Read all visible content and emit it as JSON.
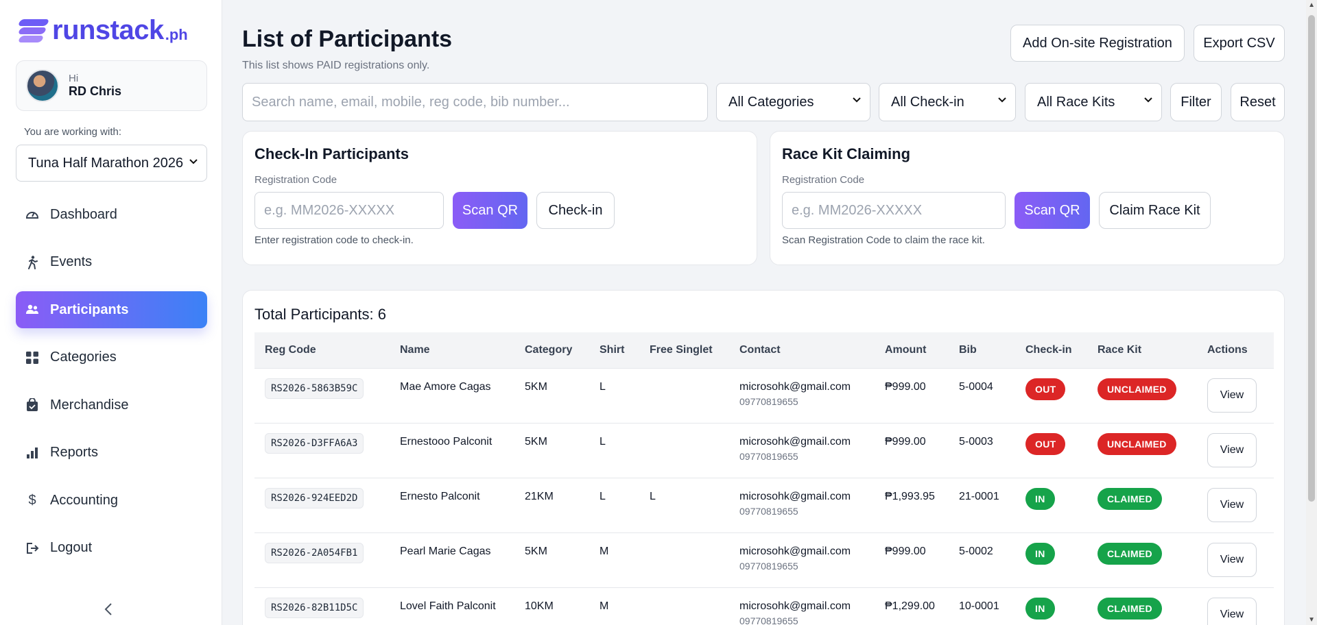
{
  "brand": {
    "name": "runstack",
    "suffix": ".ph"
  },
  "user": {
    "greeting": "Hi",
    "name": "RD Chris"
  },
  "working_with": {
    "label": "You are working with:",
    "selected_event": "Tuna Half Marathon 2026"
  },
  "nav": {
    "items": [
      {
        "label": "Dashboard",
        "icon": "gauge-icon"
      },
      {
        "label": "Events",
        "icon": "runner-icon"
      },
      {
        "label": "Participants",
        "icon": "users-icon",
        "active": true
      },
      {
        "label": "Categories",
        "icon": "grid-icon"
      },
      {
        "label": "Merchandise",
        "icon": "bag-icon"
      },
      {
        "label": "Reports",
        "icon": "bar-chart-icon"
      },
      {
        "label": "Accounting",
        "icon": "dollar-icon"
      },
      {
        "label": "Logout",
        "icon": "logout-icon"
      }
    ],
    "collapse": "‹"
  },
  "header": {
    "title": "List of Participants",
    "subtitle": "This list shows PAID registrations only.",
    "add_onsite": "Add On-site Registration",
    "export_csv": "Export CSV"
  },
  "filters": {
    "search_placeholder": "Search name, email, mobile, reg code, bib number...",
    "category": "All Categories",
    "checkin": "All Check-in",
    "race_kit": "All Race Kits",
    "filter_btn": "Filter",
    "reset_btn": "Reset"
  },
  "checkin_card": {
    "title": "Check-In Participants",
    "label": "Registration Code",
    "placeholder": "e.g. MM2026-XXXXX",
    "scan_btn": "Scan QR",
    "action_btn": "Check-in",
    "help": "Enter registration code to check-in."
  },
  "racekit_card": {
    "title": "Race Kit Claiming",
    "label": "Registration Code",
    "placeholder": "e.g. MM2026-XXXXX",
    "scan_btn": "Scan QR",
    "action_btn": "Claim Race Kit",
    "help": "Scan Registration Code to claim the race kit."
  },
  "table": {
    "total_label": "Total Participants: 6",
    "columns": [
      "Reg Code",
      "Name",
      "Category",
      "Shirt",
      "Free Singlet",
      "Contact",
      "Amount",
      "Bib",
      "Check-in",
      "Race Kit",
      "Actions"
    ],
    "rows": [
      {
        "reg": "RS2026-5863B59C",
        "name": "Mae Amore Cagas",
        "category": "5KM",
        "shirt": "L",
        "singlet": "",
        "email": "microsohk@gmail.com",
        "phone": "09770819655",
        "amount": "₱999.00",
        "bib": "5-0004",
        "checkin": "OUT",
        "racekit": "UNCLAIMED",
        "action": "View"
      },
      {
        "reg": "RS2026-D3FFA6A3",
        "name": "Ernestooo Palconit",
        "category": "5KM",
        "shirt": "L",
        "singlet": "",
        "email": "microsohk@gmail.com",
        "phone": "09770819655",
        "amount": "₱999.00",
        "bib": "5-0003",
        "checkin": "OUT",
        "racekit": "UNCLAIMED",
        "action": "View"
      },
      {
        "reg": "RS2026-924EED2D",
        "name": "Ernesto Palconit",
        "category": "21KM",
        "shirt": "L",
        "singlet": "L",
        "email": "microsohk@gmail.com",
        "phone": "09770819655",
        "amount": "₱1,993.95",
        "bib": "21-0001",
        "checkin": "IN",
        "racekit": "CLAIMED",
        "action": "View"
      },
      {
        "reg": "RS2026-2A054FB1",
        "name": "Pearl Marie Cagas",
        "category": "5KM",
        "shirt": "M",
        "singlet": "",
        "email": "microsohk@gmail.com",
        "phone": "09770819655",
        "amount": "₱999.00",
        "bib": "5-0002",
        "checkin": "IN",
        "racekit": "CLAIMED",
        "action": "View"
      },
      {
        "reg": "RS2026-82B11D5C",
        "name": "Lovel Faith Palconit",
        "category": "10KM",
        "shirt": "M",
        "singlet": "",
        "email": "microsohk@gmail.com",
        "phone": "09770819655",
        "amount": "₱1,299.00",
        "bib": "10-0001",
        "checkin": "IN",
        "racekit": "CLAIMED",
        "action": "View"
      }
    ]
  },
  "colors": {
    "accent_start": "#8b5cf6",
    "accent_end": "#3b82f6",
    "status_red": "#dc2626",
    "status_green": "#16a34a"
  }
}
